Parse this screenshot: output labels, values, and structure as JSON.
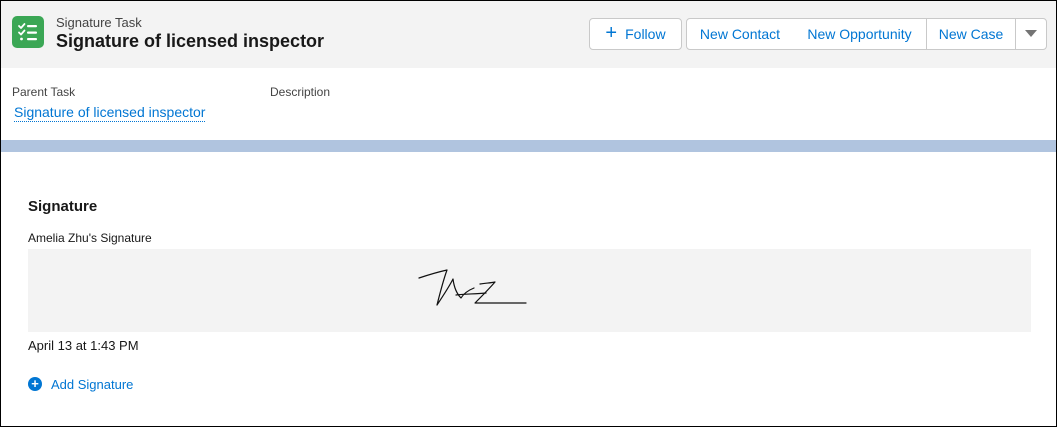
{
  "header": {
    "icon": "task-checklist-icon",
    "object_label": "Signature Task",
    "title": "Signature of licensed inspector",
    "buttons": {
      "follow": "Follow",
      "new_contact": "New Contact",
      "new_opportunity": "New Opportunity",
      "new_case": "New Case",
      "more_icon": "chevron-down-icon"
    }
  },
  "highlights": {
    "parent_task_label": "Parent Task",
    "parent_task_value": "Signature of licensed inspector",
    "description_label": "Description"
  },
  "signature_section": {
    "title": "Signature",
    "owner_label": "Amelia Zhu's Signature",
    "timestamp": "April 13 at 1:43 PM",
    "add_label": "Add Signature"
  },
  "colors": {
    "brand_blue": "#0176d3",
    "icon_green": "#3ba755",
    "header_bg": "#f3f3f3",
    "band": "#b0c4df"
  }
}
